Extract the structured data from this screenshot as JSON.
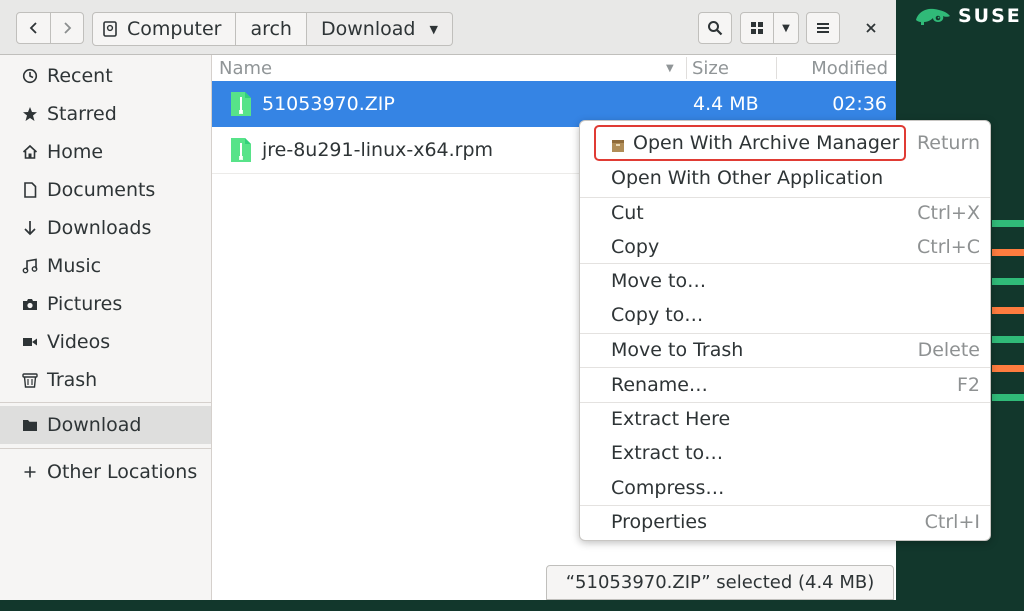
{
  "branding": {
    "name": "SUSE",
    "logo_color": "#30ba78"
  },
  "desktop": {
    "background": "#12372c",
    "stripe_colors": [
      "#30ba78",
      "#fe7c3f",
      "#2453ff",
      "#cfd2d1"
    ]
  },
  "headerbar": {
    "breadcrumbs": [
      "Computer",
      "arch",
      "Download"
    ],
    "icons": {
      "back": "chevron-left-icon",
      "forward": "chevron-right-icon",
      "computer": "computer-icon",
      "search": "search-icon",
      "view": "grid-view-icon",
      "view_dropdown": "chevron-down-icon",
      "menu": "hamburger-menu-icon",
      "close": "close-icon"
    }
  },
  "sidebar": {
    "items": [
      {
        "label": "Recent",
        "icon": "clock-icon"
      },
      {
        "label": "Starred",
        "icon": "star-icon"
      },
      {
        "label": "Home",
        "icon": "home-icon"
      },
      {
        "label": "Documents",
        "icon": "document-icon"
      },
      {
        "label": "Downloads",
        "icon": "download-arrow-icon"
      },
      {
        "label": "Music",
        "icon": "music-note-icon"
      },
      {
        "label": "Pictures",
        "icon": "camera-icon"
      },
      {
        "label": "Videos",
        "icon": "video-icon"
      },
      {
        "label": "Trash",
        "icon": "trash-icon"
      }
    ],
    "bookmarks": [
      {
        "label": "Download",
        "icon": "folder-icon",
        "active": true
      }
    ],
    "other": {
      "label": "Other Locations",
      "icon": "plus-icon"
    }
  },
  "file_list": {
    "columns": {
      "name": "Name",
      "size": "Size",
      "modified": "Modified"
    },
    "rows": [
      {
        "name": "51053970.ZIP",
        "size": "4.4 MB",
        "modified": "02:36",
        "selected": true,
        "icon": "archive-file-icon"
      },
      {
        "name": "jre-8u291-linux-x64.rpm",
        "size": "",
        "modified": "",
        "selected": false,
        "icon": "archive-file-icon"
      }
    ]
  },
  "context_menu": {
    "items": [
      {
        "label": "Open With Archive Manager",
        "accel": "Return",
        "icon": "archive-manager-icon",
        "highlighted": true
      },
      {
        "label": "Open With Other Application",
        "accel": ""
      },
      {
        "label": "Cut",
        "accel": "Ctrl+X"
      },
      {
        "label": "Copy",
        "accel": "Ctrl+C"
      },
      {
        "label": "Move to…",
        "accel": ""
      },
      {
        "label": "Copy to…",
        "accel": ""
      },
      {
        "label": "Move to Trash",
        "accel": "Delete"
      },
      {
        "label": "Rename…",
        "accel": "F2"
      },
      {
        "label": "Extract Here",
        "accel": ""
      },
      {
        "label": "Extract to…",
        "accel": ""
      },
      {
        "label": "Compress…",
        "accel": ""
      },
      {
        "label": "Properties",
        "accel": "Ctrl+I"
      }
    ],
    "highlight_color": "#e03b34"
  },
  "status": {
    "text": "“51053970.ZIP” selected (4.4 MB)"
  },
  "colors": {
    "selection": "#3584e4",
    "file_icon": "#57e389"
  }
}
